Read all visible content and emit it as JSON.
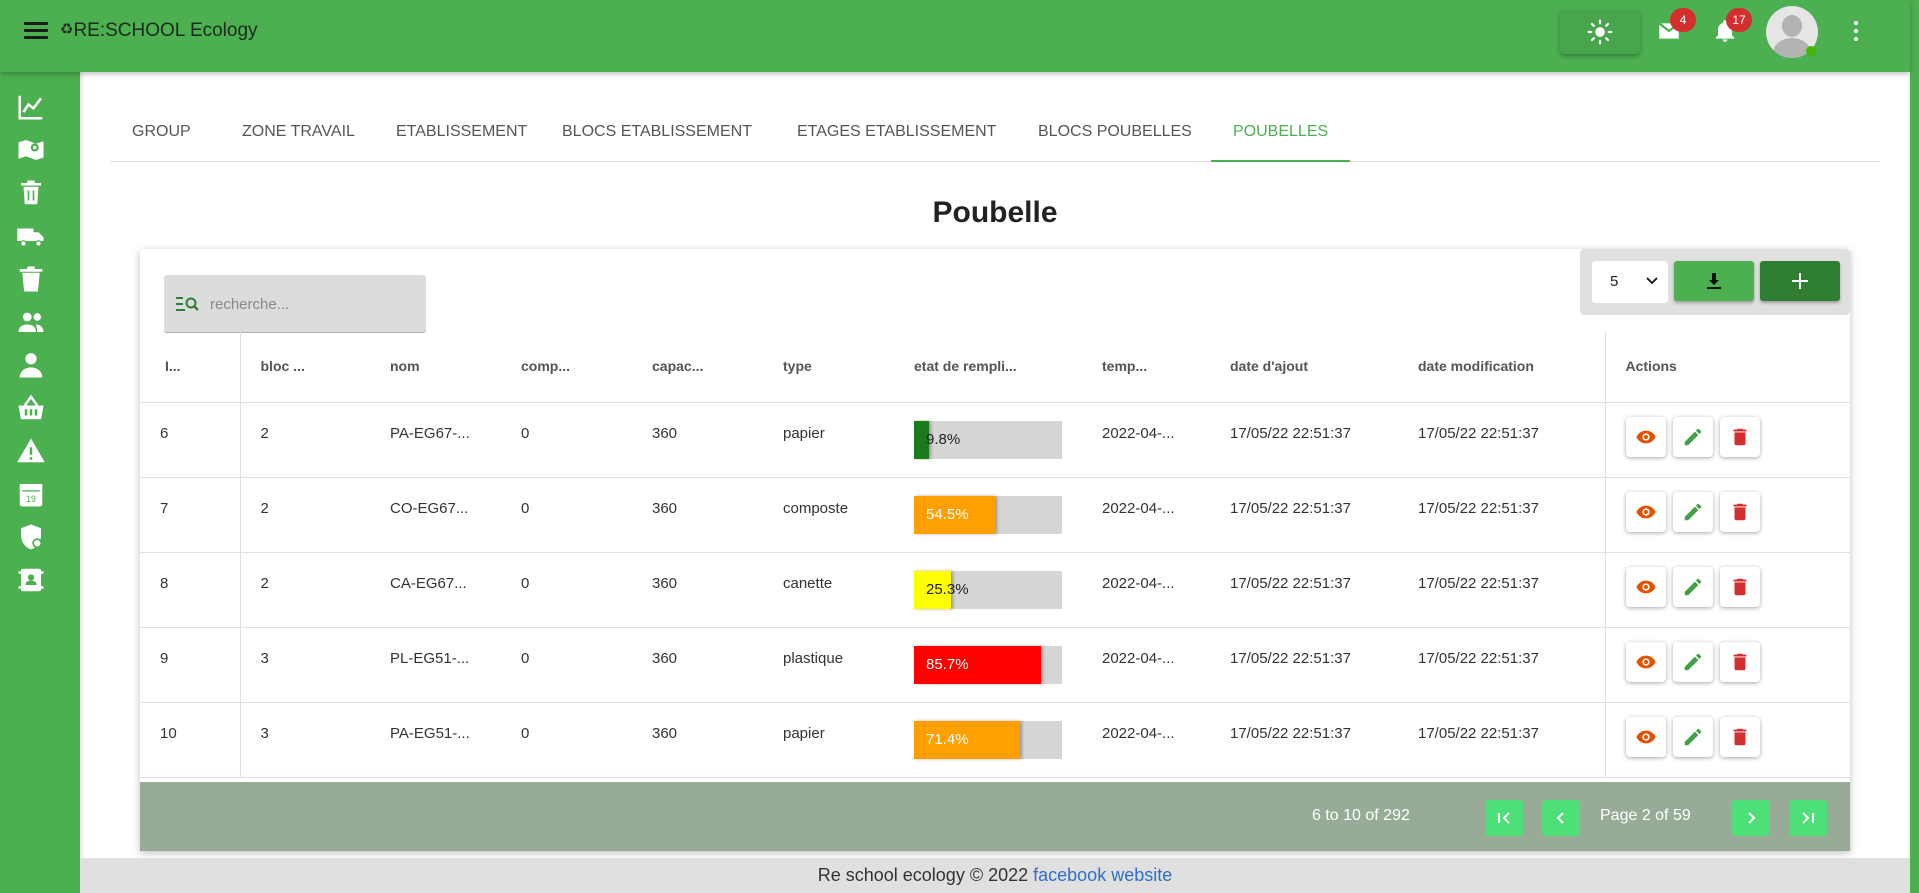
{
  "app": {
    "title": "RE:SCHOOL Ecology",
    "icon": "recycle-icon",
    "mail_count": "4",
    "notif_count": "17"
  },
  "colors": {
    "primary": "#4caf50",
    "primary_dark": "#2e7d32",
    "danger": "#d32f2f",
    "view": "#e65100",
    "pager_bg": "#98ab97",
    "pager_button": "#4de078"
  },
  "sidebar": {
    "items": [
      {
        "icon": "chart-line-icon"
      },
      {
        "icon": "map-marker-icon"
      },
      {
        "icon": "trash-can-icon"
      },
      {
        "icon": "truck-icon"
      },
      {
        "icon": "trash-icon"
      },
      {
        "icon": "group-icon"
      },
      {
        "icon": "person-icon"
      },
      {
        "icon": "basket-icon"
      },
      {
        "icon": "warning-icon"
      },
      {
        "icon": "calendar-icon"
      },
      {
        "icon": "shield-icon"
      },
      {
        "icon": "contact-icon"
      }
    ]
  },
  "tabs": [
    {
      "label": "GROUP",
      "active": false
    },
    {
      "label": "ZONE TRAVAIL",
      "active": false
    },
    {
      "label": "ETABLISSEMENT",
      "active": false
    },
    {
      "label": "BLOCS ETABLISSEMENT",
      "active": false
    },
    {
      "label": "ETAGES ETABLISSEMENT",
      "active": false
    },
    {
      "label": "BLOCS POUBELLES",
      "active": false
    },
    {
      "label": "POUBELLES",
      "active": true
    }
  ],
  "page": {
    "title": "Poubelle"
  },
  "search": {
    "placeholder": "recherche..."
  },
  "toolbar": {
    "page_size": "5"
  },
  "table": {
    "headers": [
      "I...",
      "bloc ...",
      "nom",
      "comp...",
      "capac...",
      "type",
      "etat de rempli...",
      "temp...",
      "date d'ajout",
      "date modification",
      "Actions"
    ],
    "rows": [
      {
        "id": "6",
        "bloc": "2",
        "nom": "PA-EG67-...",
        "comp": "0",
        "capac": "360",
        "type": "papier",
        "fill_label": "9.8%",
        "fill": 9.8,
        "fill_color": "#1b7a1b",
        "temp": "2022-04-...",
        "date_ajout": "17/05/22 22:51:37",
        "date_modif": "17/05/22 22:51:37"
      },
      {
        "id": "7",
        "bloc": "2",
        "nom": "CO-EG67...",
        "comp": "0",
        "capac": "360",
        "type": "composte",
        "fill_label": "54.5%",
        "fill": 54.5,
        "fill_color": "#ffa000",
        "temp": "2022-04-...",
        "date_ajout": "17/05/22 22:51:37",
        "date_modif": "17/05/22 22:51:37"
      },
      {
        "id": "8",
        "bloc": "2",
        "nom": "CA-EG67...",
        "comp": "0",
        "capac": "360",
        "type": "canette",
        "fill_label": "25.3%",
        "fill": 25.3,
        "fill_color": "#ffff00",
        "temp": "2022-04-...",
        "date_ajout": "17/05/22 22:51:37",
        "date_modif": "17/05/22 22:51:37"
      },
      {
        "id": "9",
        "bloc": "3",
        "nom": "PL-EG51-...",
        "comp": "0",
        "capac": "360",
        "type": "plastique",
        "fill_label": "85.7%",
        "fill": 85.7,
        "fill_color": "#ff0000",
        "temp": "2022-04-...",
        "date_ajout": "17/05/22 22:51:37",
        "date_modif": "17/05/22 22:51:37"
      },
      {
        "id": "10",
        "bloc": "3",
        "nom": "PA-EG51-...",
        "comp": "0",
        "capac": "360",
        "type": "papier",
        "fill_label": "71.4%",
        "fill": 71.4,
        "fill_color": "#ffa000",
        "temp": "2022-04-...",
        "date_ajout": "17/05/22 22:51:37",
        "date_modif": "17/05/22 22:51:37"
      }
    ]
  },
  "pager": {
    "range": "6 to 10 of 292",
    "page_label": "Page 2 of 59"
  },
  "footer": {
    "text": "Re school ecology © 2022 ",
    "link1": "facebook",
    "link2": "website"
  }
}
